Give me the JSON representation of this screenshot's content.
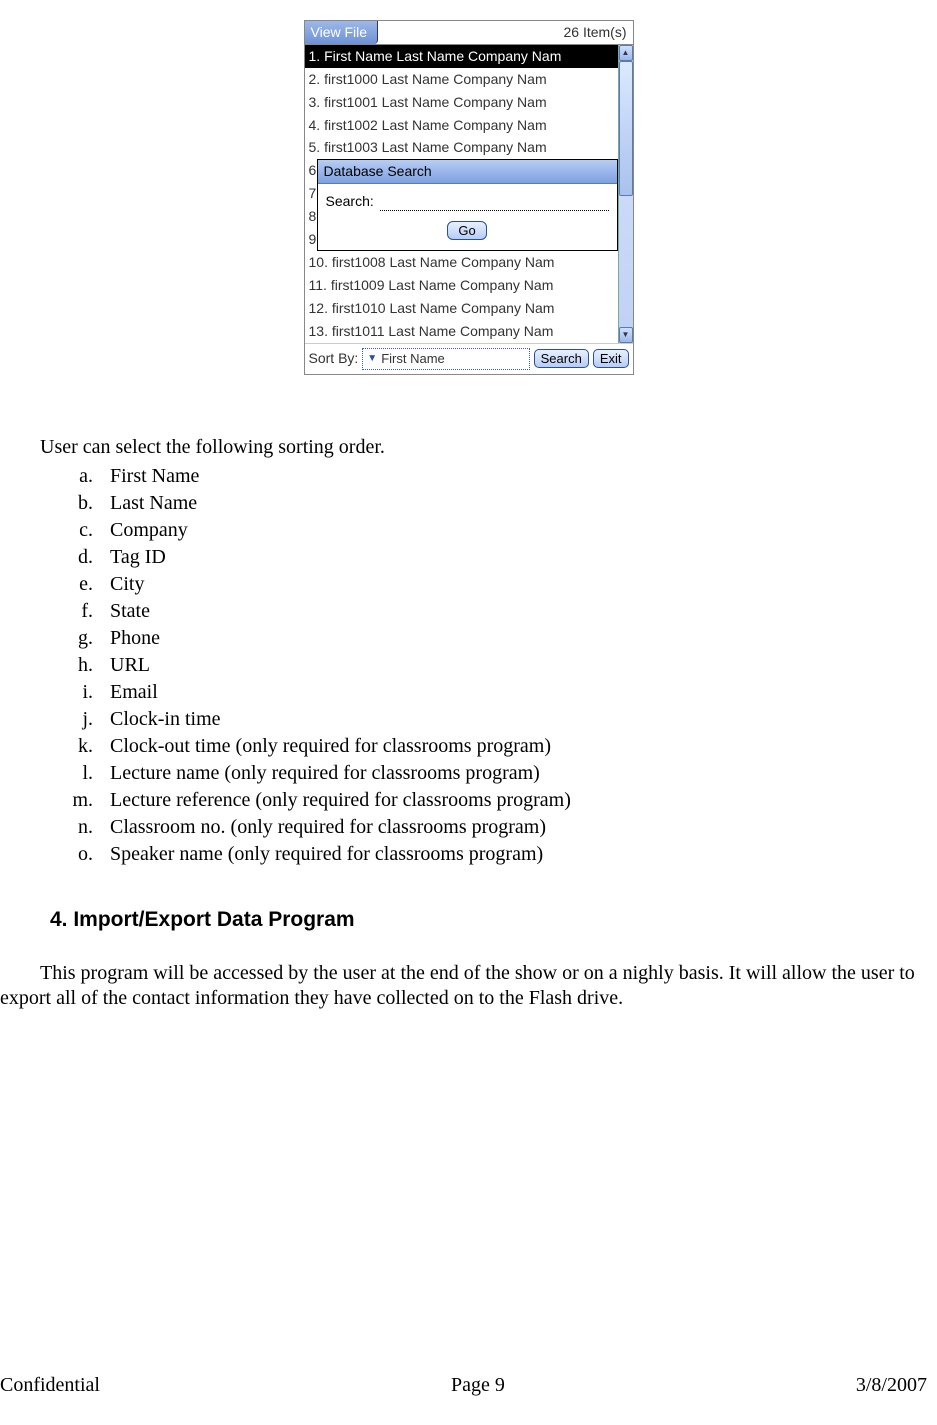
{
  "device": {
    "title": "View File",
    "item_count": "26 Item(s)",
    "rows_top": [
      "1. First Name Last Name  Company Nam",
      "2. first1000 Last Name  Company Nam",
      "3. first1001 Last Name  Company Nam",
      "4. first1002 Last Name  Company Nam",
      "5. first1003 Last Name  Company Nam"
    ],
    "partial_nums": [
      "6",
      "7",
      "8",
      "9"
    ],
    "rows_bottom": [
      "10. first1008 Last Name  Company Nam",
      "11. first1009 Last Name  Company Nam",
      "12. first1010 Last Name  Company Nam",
      "13. first1011 Last Name  Company Nam"
    ],
    "popup": {
      "title": "Database Search",
      "search_label": "Search:",
      "go": "Go"
    },
    "bottom": {
      "sort_by": "Sort By:",
      "sort_value": "First Name",
      "search_btn": "Search",
      "exit_btn": "Exit"
    }
  },
  "doc": {
    "sort_intro": "User can select the following sorting order.",
    "sort_items": [
      "First Name",
      "Last Name",
      "Company",
      "Tag ID",
      "City",
      "State",
      "Phone",
      "URL",
      "Email",
      "Clock-in time",
      "Clock-out time (only required for classrooms program)",
      "Lecture name (only required for classrooms program)",
      "Lecture reference (only required for classrooms program)",
      "Classroom no. (only required for classrooms program)",
      "Speaker name (only required for classrooms program)"
    ],
    "section_heading": "4.  Import/Export Data Program",
    "body": "This program will be accessed by the user at the end of the show or on a nighly basis. It will allow the user to export all of the contact information they have collected on to the Flash drive."
  },
  "footer": {
    "left": "Confidential",
    "center": "Page 9",
    "right": "3/8/2007"
  }
}
